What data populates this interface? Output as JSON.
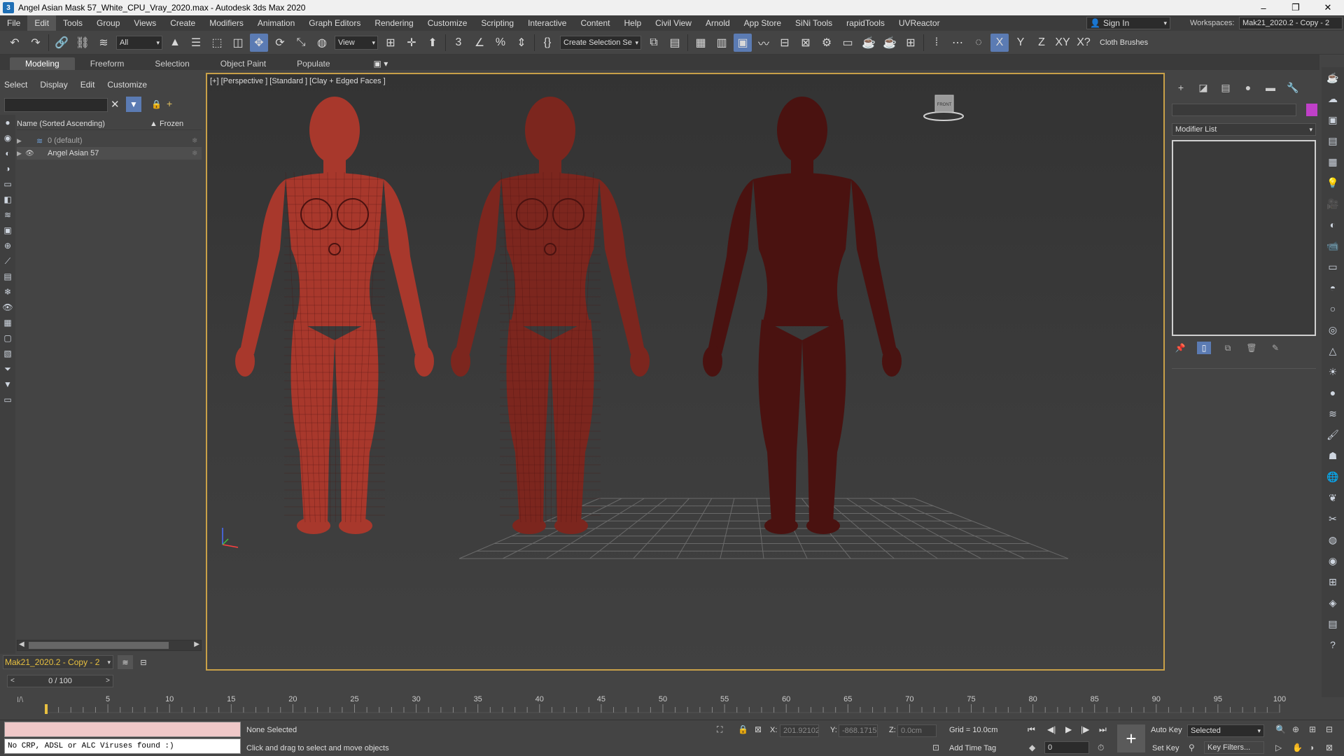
{
  "window": {
    "title": "Angel Asian Mask 57_White_CPU_Vray_2020.max - Autodesk 3ds Max 2020",
    "app_icon": "3",
    "controls": {
      "minimize": "–",
      "maximize": "❐",
      "close": "✕"
    }
  },
  "menubar": {
    "items": [
      "File",
      "Edit",
      "Tools",
      "Group",
      "Views",
      "Create",
      "Modifiers",
      "Animation",
      "Graph Editors",
      "Rendering",
      "Customize",
      "Scripting",
      "Interactive",
      "Content",
      "Help",
      "Civil View",
      "Arnold",
      "App Store",
      "SiNi Tools",
      "rapidTools",
      "UVReactor"
    ],
    "active_index": 1,
    "sign_in": "Sign In",
    "workspace_label": "Workspaces:",
    "workspace_value": "Mak21_2020.2 - Copy - 2"
  },
  "toolbar": {
    "selection_filter": "All",
    "ref_coord": "View",
    "selection_set": "Create Selection Se",
    "axis_x": "X",
    "axis_y": "Y",
    "axis_z": "Z",
    "axis_xy": "XY",
    "axis_xyq": "X?",
    "cloth_brushes": "Cloth Brushes"
  },
  "ribbon": {
    "tabs": [
      "Modeling",
      "Freeform",
      "Selection",
      "Object Paint",
      "Populate"
    ],
    "active_index": 0,
    "options_icon": "▣ ▾"
  },
  "scene_explorer": {
    "menu": [
      "Select",
      "Display",
      "Edit",
      "Customize"
    ],
    "header_name": "Name (Sorted Ascending)",
    "header_frozen": "▲ Frozen",
    "rows": [
      {
        "label": "0 (default)"
      },
      {
        "label": "Angel Asian 57"
      }
    ],
    "layer": "Mak21_2020.2 - Copy - 2"
  },
  "viewport": {
    "label": "[+] [Perspective ] [Standard ] [Clay + Edged Faces ]",
    "viewcube_label": "FRONT",
    "colors": {
      "figure_light": "#a8382c",
      "figure_mid": "#7c261e",
      "figure_dark": "#4a1210",
      "grid": "#6a6a6a"
    }
  },
  "command_panel": {
    "modifier_list": "Modifier List",
    "object_color": "#c040c8"
  },
  "timeline": {
    "frame_display": "0 / 100",
    "ticks": [
      5,
      10,
      15,
      20,
      25,
      30,
      35,
      40,
      45,
      50,
      55,
      60,
      65,
      70,
      75,
      80,
      85,
      90,
      95,
      100
    ],
    "key_icon": "I/\\"
  },
  "status": {
    "listener_output": "No CRP, ADSL or ALC Viruses found :)",
    "selection": "None Selected",
    "prompt": "Click and drag to select and move objects",
    "x_label": "X:",
    "x_value": "201.92102",
    "y_label": "Y:",
    "y_value": "-868.1715",
    "z_label": "Z:",
    "z_value": "0.0cm",
    "grid": "Grid = 10.0cm",
    "add_time_tag": "Add Time Tag",
    "auto_key": "Auto Key",
    "set_key": "Set Key",
    "key_mode": "Selected",
    "key_filters": "Key Filters...",
    "current_frame": "0"
  }
}
